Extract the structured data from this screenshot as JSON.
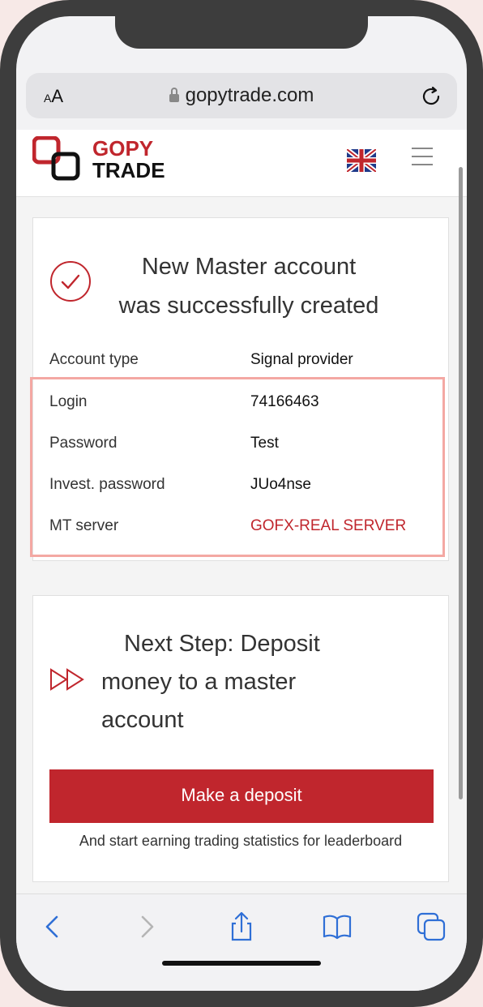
{
  "browser": {
    "text_size_label": "AA",
    "url": "gopytrade.com"
  },
  "header": {
    "logo_top": "GOPY",
    "logo_bottom": "TRADE"
  },
  "success_card": {
    "title_line1": "New Master account",
    "title_line2": "was successfully created",
    "rows": [
      {
        "label": "Account type",
        "value": "Signal provider"
      },
      {
        "label": "Login",
        "value": "74166463"
      },
      {
        "label": "Password",
        "value": "Test"
      },
      {
        "label": "Invest. password",
        "value": "JUo4nse"
      },
      {
        "label": "MT server",
        "value": "GOFX-REAL SERVER"
      }
    ]
  },
  "next_step_card": {
    "title_lines": [
      "Next Step: Deposit",
      "money to a master",
      "account"
    ],
    "button_label": "Make a deposit",
    "note": "And start earning trading statistics for leaderboard"
  },
  "colors": {
    "accent": "#c0262d",
    "highlight": "#f4a8a3"
  },
  "icons": [
    "lock-icon",
    "reload-icon",
    "check-circle-icon",
    "fast-forward-icon",
    "back-icon",
    "forward-icon",
    "share-icon",
    "bookmarks-icon",
    "tabs-icon"
  ]
}
